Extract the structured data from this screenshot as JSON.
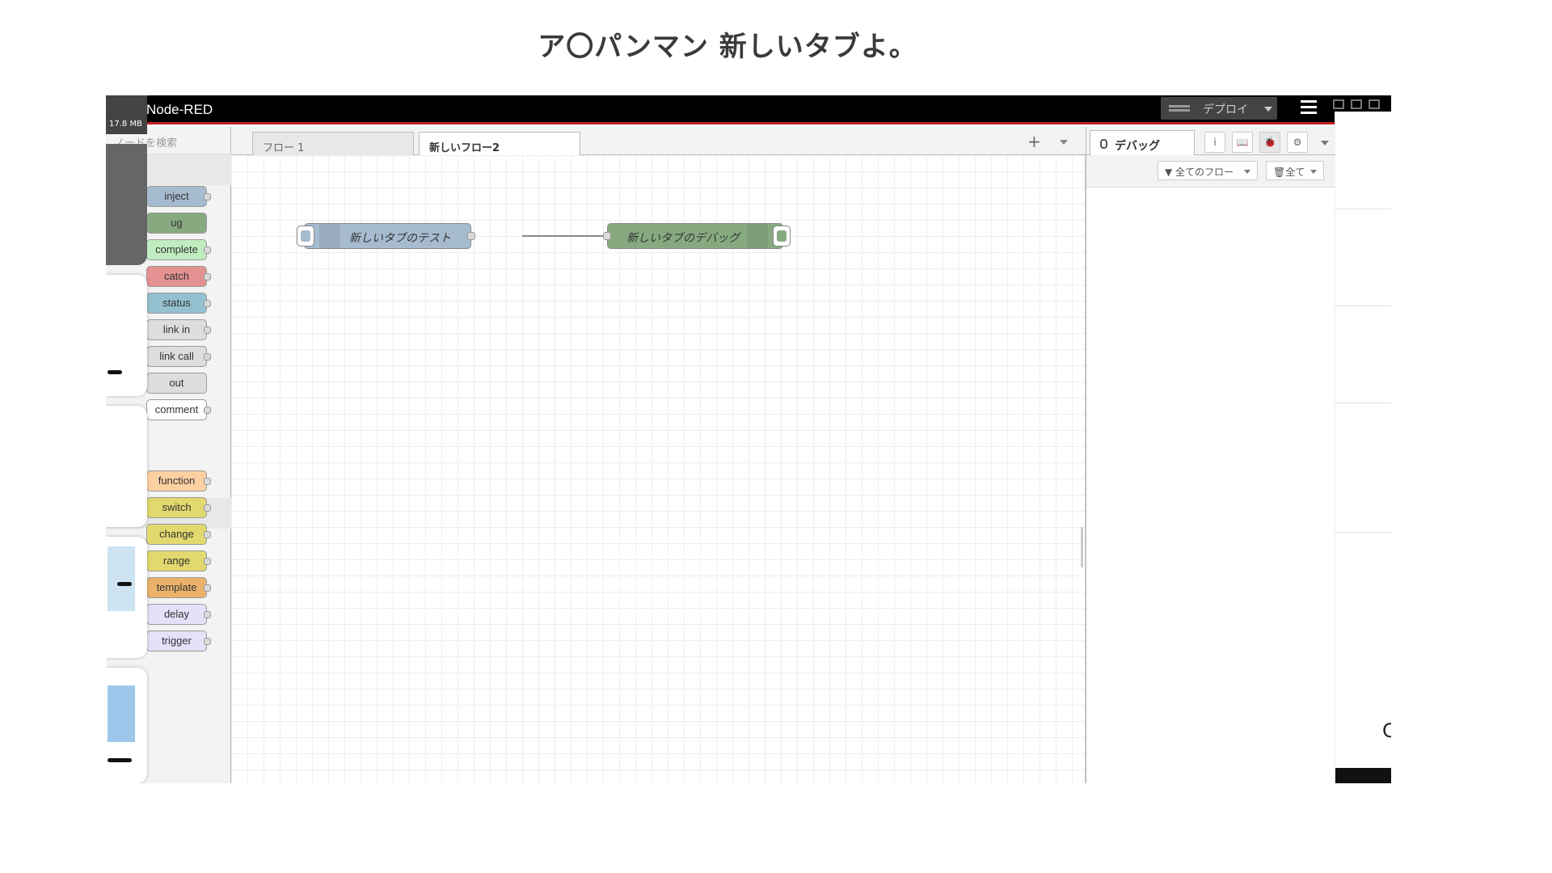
{
  "slide": {
    "title": "ア〇パンマン 新しいタブよ。"
  },
  "header": {
    "title": "Node-RED",
    "deploy_label": "デプロイ"
  },
  "overlay": {
    "memory": "17.8 MB"
  },
  "palette": {
    "search_placeholder": "ノードを検索",
    "nodes": [
      "inject",
      "ug",
      "complete",
      "catch",
      "status",
      "link in",
      "link call",
      "out",
      "comment",
      "function",
      "switch",
      "change",
      "range",
      "template",
      "delay",
      "trigger"
    ],
    "colors": [
      "#a6bbcf",
      "#87a980",
      "#c0edc0",
      "#e49191",
      "#94c1d0",
      "#dddddd",
      "#dddddd",
      "#dddddd",
      "#ffffff",
      "#fdd0a2",
      "#e2d96e",
      "#e2d96e",
      "#e2d96e",
      "#ebb36a",
      "#e6e0f8",
      "#e6e0f8"
    ]
  },
  "workspace": {
    "tabs": [
      "フロー 1",
      "新しいフロー2"
    ],
    "active_tab": 1,
    "nodes": [
      {
        "label": "新しいタブのテスト",
        "type": "inject",
        "color": "#a6bbcf"
      },
      {
        "label": "新しいタブのデバッグ",
        "type": "debug",
        "color": "#87a980"
      }
    ]
  },
  "sidebar": {
    "tab_label": "デバッグ",
    "buttons": [
      "i",
      "📖",
      "🐞",
      "⚙"
    ],
    "filter_label": "全てのフロー",
    "clear_label": "全て"
  }
}
